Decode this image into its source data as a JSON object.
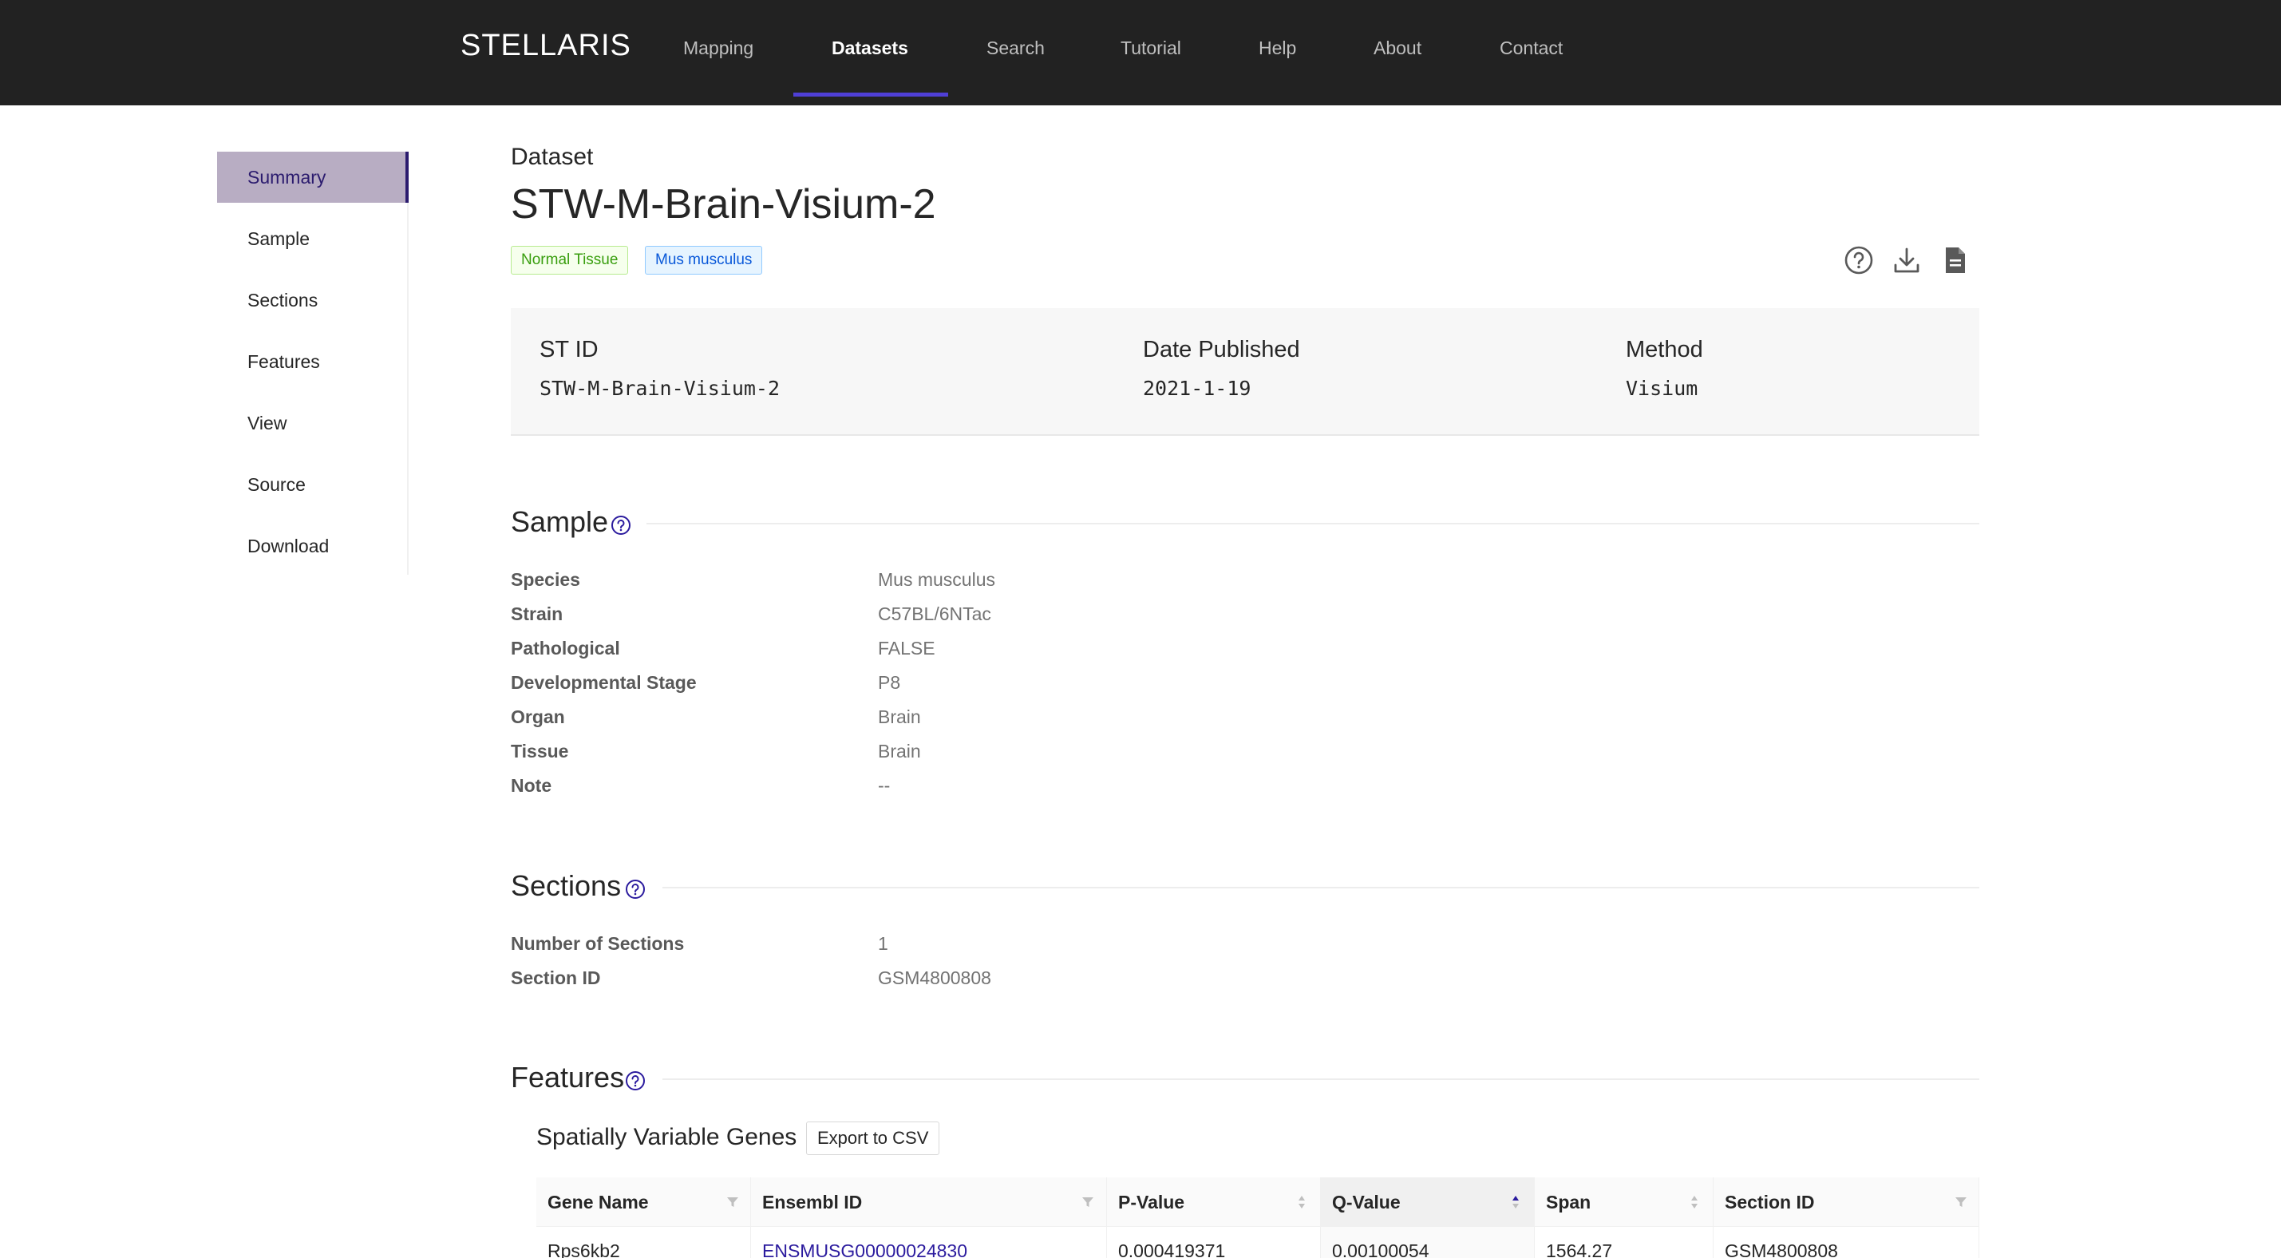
{
  "app": {
    "logo": "STELLARIS"
  },
  "nav": {
    "items": [
      {
        "label": "Mapping"
      },
      {
        "label": "Datasets"
      },
      {
        "label": "Search"
      },
      {
        "label": "Tutorial"
      },
      {
        "label": "Help"
      },
      {
        "label": "About"
      },
      {
        "label": "Contact"
      }
    ],
    "active": "Datasets"
  },
  "sidebar": {
    "items": [
      {
        "label": "Summary"
      },
      {
        "label": "Sample"
      },
      {
        "label": "Sections"
      },
      {
        "label": "Features"
      },
      {
        "label": "View"
      },
      {
        "label": "Source"
      },
      {
        "label": "Download"
      }
    ],
    "active": "Summary"
  },
  "header": {
    "kicker": "Dataset",
    "title": "STW-M-Brain-Visium-2",
    "tags": [
      {
        "label": "Normal Tissue",
        "color": "#389e0d"
      },
      {
        "label": "Mus musculus",
        "color": "#0958d9"
      }
    ],
    "tool_icons": [
      "question-circle-icon",
      "download-icon",
      "file-text-icon"
    ]
  },
  "info": {
    "st_id_label": "ST ID",
    "st_id_value": "STW-M-Brain-Visium-2",
    "date_label": "Date Published",
    "date_value": "2021-1-19",
    "method_label": "Method",
    "method_value": "Visium"
  },
  "sample": {
    "heading": "Sample",
    "rows": [
      {
        "label": "Species",
        "value": "Mus musculus"
      },
      {
        "label": "Strain",
        "value": "C57BL/6NTac"
      },
      {
        "label": "Pathological",
        "value": "FALSE"
      },
      {
        "label": "Developmental Stage",
        "value": "P8"
      },
      {
        "label": "Organ",
        "value": "Brain"
      },
      {
        "label": "Tissue",
        "value": "Brain"
      },
      {
        "label": "Note",
        "value": "--"
      }
    ]
  },
  "sections": {
    "heading": "Sections",
    "rows": [
      {
        "label": "Number of Sections",
        "value": "1"
      },
      {
        "label": "Section ID",
        "value": "GSM4800808"
      }
    ]
  },
  "features": {
    "heading": "Features",
    "subheading": "Spatially Variable Genes",
    "export_label": "Export to CSV",
    "table": {
      "columns": [
        "Gene Name",
        "Ensembl ID",
        "P-Value",
        "Q-Value",
        "Span",
        "Section ID"
      ],
      "sorted_column": "Q-Value",
      "rows": [
        [
          "Rps6kb2",
          "ENSMUSG00000024830",
          "0.000419371",
          "0.00100054",
          "1564.27",
          "GSM4800808"
        ]
      ]
    }
  },
  "colors": {
    "accent": "#4f3fd6",
    "link": "#2b1b9e",
    "topbar": "#222222"
  }
}
